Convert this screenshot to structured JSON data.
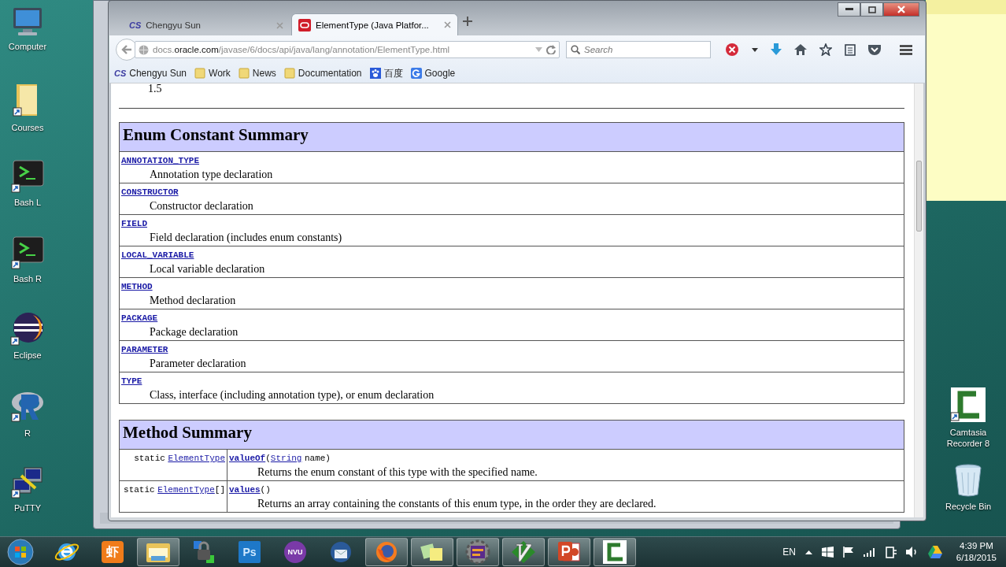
{
  "desktop_icons_left": [
    {
      "label": "Computer",
      "kind": "computer"
    },
    {
      "label": "Courses",
      "kind": "folder"
    },
    {
      "label": "Bash L",
      "kind": "terminal"
    },
    {
      "label": "Bash R",
      "kind": "terminal"
    },
    {
      "label": "Eclipse",
      "kind": "eclipse"
    },
    {
      "label": "R",
      "kind": "r"
    },
    {
      "label": "PuTTY",
      "kind": "putty"
    }
  ],
  "desktop_icons_right": [
    {
      "label": "Camtasia Recorder 8",
      "kind": "camtasia"
    },
    {
      "label": "Recycle Bin",
      "kind": "recycle"
    }
  ],
  "browser": {
    "tabs": [
      {
        "label": "Chengyu Sun",
        "badge": "CS",
        "kind": "cs",
        "selected": false
      },
      {
        "label": "ElementType (Java Platfor...",
        "kind": "oracle",
        "selected": true
      }
    ],
    "url": {
      "host_prefix": "docs.",
      "host": "oracle.com",
      "path": "/javase/6/docs/api/java/lang/annotation/ElementType.html"
    },
    "search": {
      "placeholder": "Search"
    },
    "bookmarks": [
      {
        "label": "Chengyu Sun",
        "badge": "CS",
        "kind": "cs"
      },
      {
        "label": "Work",
        "kind": "folder"
      },
      {
        "label": "News",
        "kind": "folder"
      },
      {
        "label": "Documentation",
        "kind": "folder"
      },
      {
        "label": "百度",
        "kind": "paw"
      },
      {
        "label": "Google",
        "kind": "google"
      }
    ]
  },
  "page": {
    "since": "1.5",
    "enum_summary": {
      "title": "Enum Constant Summary",
      "rows": [
        {
          "name": "ANNOTATION_TYPE",
          "description": "Annotation type declaration"
        },
        {
          "name": "CONSTRUCTOR",
          "description": "Constructor declaration"
        },
        {
          "name": "FIELD",
          "description": "Field declaration (includes enum constants)"
        },
        {
          "name": "LOCAL_VARIABLE",
          "description": "Local variable declaration"
        },
        {
          "name": "METHOD",
          "description": "Method declaration"
        },
        {
          "name": "PACKAGE",
          "description": "Package declaration"
        },
        {
          "name": "PARAMETER",
          "description": "Parameter declaration"
        },
        {
          "name": "TYPE",
          "description": "Class, interface (including annotation type), or enum declaration"
        }
      ]
    },
    "method_summary": {
      "title": "Method Summary",
      "rows": [
        {
          "modifier": "static",
          "type": "ElementType",
          "type_suffix": "",
          "method": "valueOf",
          "open": "(",
          "param_type": "String",
          "param_name": "name)",
          "description": "Returns the enum constant of this type with the specified name."
        },
        {
          "modifier": "static",
          "type": "ElementType",
          "type_suffix": "[]",
          "method": "values",
          "open": "()",
          "description": "Returns an array containing the constants of this enum type, in the order they are declared."
        }
      ]
    }
  },
  "taskbar": {
    "apps": [
      {
        "kind": "ie",
        "running": false
      },
      {
        "kind": "xiami",
        "label": "虾",
        "running": false
      },
      {
        "kind": "explorer",
        "running": true
      },
      {
        "kind": "lock",
        "running": false
      },
      {
        "kind": "ps",
        "label": "Ps",
        "running": false
      },
      {
        "kind": "nvu",
        "label": "NVU",
        "running": false
      },
      {
        "kind": "thunderbird",
        "running": false
      },
      {
        "kind": "firefox",
        "running": true
      },
      {
        "kind": "notes",
        "running": true
      },
      {
        "kind": "javaee",
        "running": true
      },
      {
        "kind": "vim",
        "running": true
      },
      {
        "kind": "ppt",
        "running": true
      },
      {
        "kind": "camtasia",
        "running": true
      }
    ],
    "language": "EN",
    "time": "4:39 PM",
    "date": "6/18/2015"
  }
}
